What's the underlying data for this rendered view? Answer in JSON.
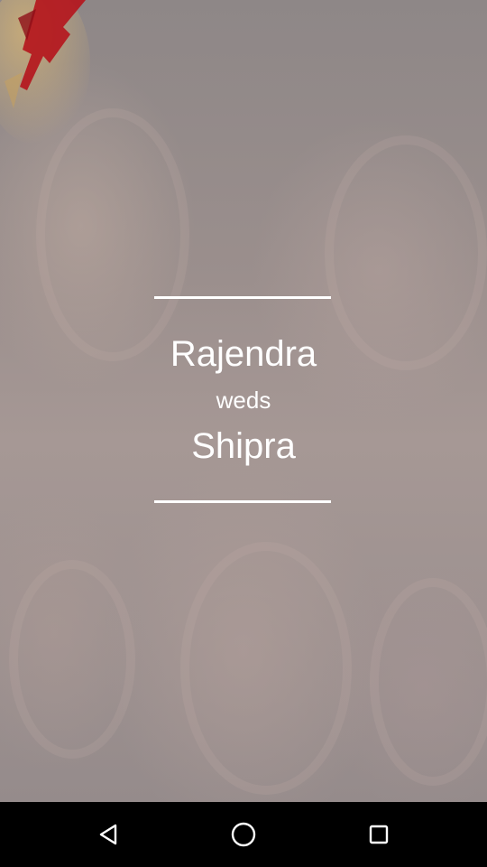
{
  "invitation": {
    "groom": "Rajendra",
    "conjunction": "weds",
    "bride": "Shipra"
  },
  "navigation_bar": {
    "back_icon": "back-triangle-icon",
    "home_icon": "home-circle-icon",
    "recents_icon": "recents-square-icon"
  },
  "colors": {
    "text": "#ffffff",
    "divider": "#ffffff",
    "navbar": "#000000",
    "ribbon_accent": "#b5141c"
  }
}
